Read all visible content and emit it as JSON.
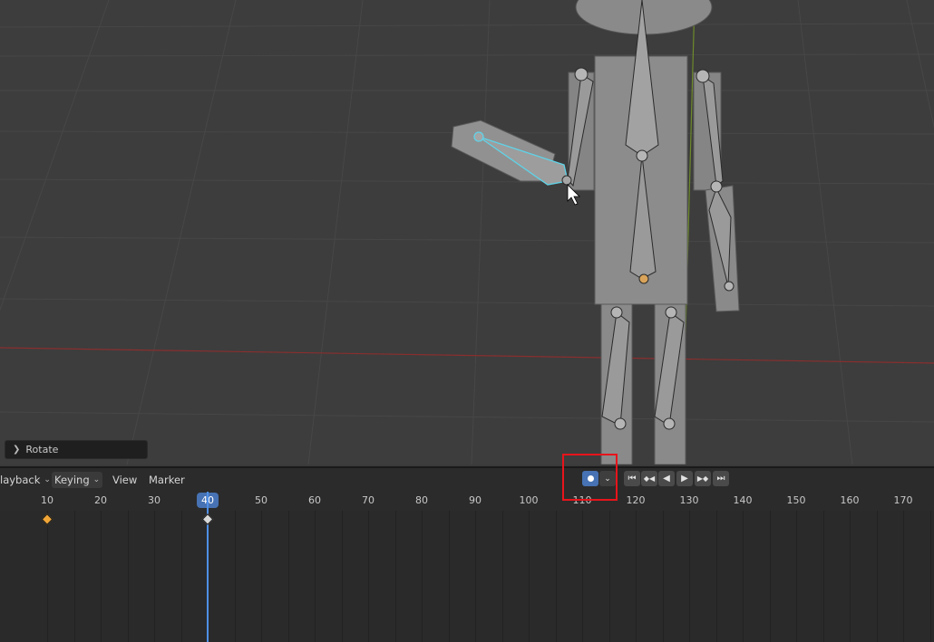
{
  "viewport": {
    "redo_panel": {
      "label": "Rotate",
      "icon": "chevron-right-icon"
    },
    "cursor_icon": "arrow-cursor-icon"
  },
  "timeline": {
    "menus": [
      {
        "label": "layback",
        "has_dropdown": true
      },
      {
        "label": "Keying",
        "has_dropdown": true
      },
      {
        "label": "View",
        "has_dropdown": false
      },
      {
        "label": "Marker",
        "has_dropdown": false
      }
    ],
    "auto_keying": {
      "icon": "record-dot-icon",
      "active": true,
      "dropdown_icon": "chevron-down-icon"
    },
    "playback_controls": [
      {
        "name": "jump-to-start-button",
        "icon": "jump-start-icon",
        "glyph": "⏮"
      },
      {
        "name": "jump-prev-keyframe-button",
        "icon": "prev-keyframe-icon",
        "glyph": "◆◀"
      },
      {
        "name": "play-reverse-button",
        "icon": "play-reverse-icon",
        "glyph": "◀"
      },
      {
        "name": "play-button",
        "icon": "play-icon",
        "glyph": "▶"
      },
      {
        "name": "jump-next-keyframe-button",
        "icon": "next-keyframe-icon",
        "glyph": "▶◆"
      },
      {
        "name": "jump-to-end-button",
        "icon": "jump-end-icon",
        "glyph": "⏭"
      }
    ],
    "ruler_ticks": [
      "10",
      "20",
      "30",
      "40",
      "50",
      "60",
      "70",
      "80",
      "90",
      "100",
      "110",
      "120",
      "130",
      "140",
      "150",
      "160",
      "170"
    ],
    "current_frame": "40",
    "keyframes": [
      {
        "frame": 10,
        "selected": true
      },
      {
        "frame": 40,
        "selected": false
      }
    ],
    "colors": {
      "accent": "#4772b3",
      "keyframe_selected": "#f0a637",
      "keyframe_unselected": "#d8d8d8",
      "highlight": "#e8141b"
    }
  }
}
